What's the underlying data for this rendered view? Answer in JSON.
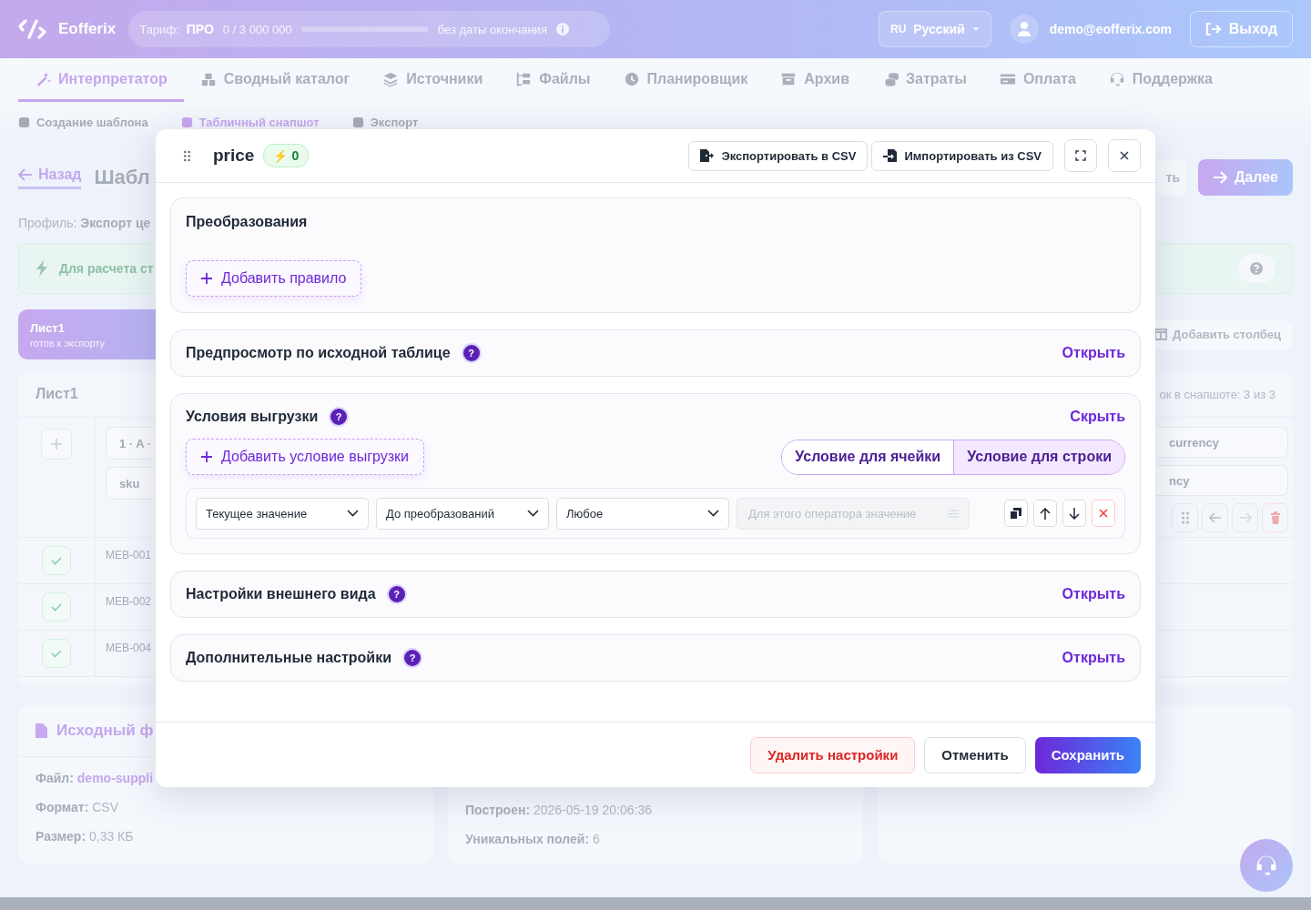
{
  "header": {
    "logo": "Eofferix",
    "plan": {
      "label": "Тариф:",
      "name": "ПРО",
      "usage": "0 / 3 000 000",
      "level": 0,
      "expiry": "без даты окончания"
    },
    "language": {
      "code": "RU",
      "name": "Русский"
    },
    "user_email": "demo@eofferix.com",
    "logout": "Выход"
  },
  "nav": [
    {
      "label": "Интерпретатор",
      "selected": true
    },
    {
      "label": "Сводный каталог",
      "selected": false
    },
    {
      "label": "Источники",
      "selected": false
    },
    {
      "label": "Файлы",
      "selected": false
    },
    {
      "label": "Планировщик",
      "selected": false
    },
    {
      "label": "Архив",
      "selected": false
    },
    {
      "label": "Затраты",
      "selected": false
    },
    {
      "label": "Оплата",
      "selected": false
    },
    {
      "label": "Поддержка",
      "selected": false
    }
  ],
  "subtabs": [
    {
      "label": "Создание шаблона",
      "selected": false
    },
    {
      "label": "Табличный снапшот",
      "selected": true
    },
    {
      "label": "Экспорт",
      "selected": false
    }
  ],
  "page": {
    "back": "Назад",
    "title": "Шабл",
    "cut_button": "ть",
    "next": "Далее",
    "profile_label": "Профиль:",
    "profile_value": "Экспорт це",
    "banner": "Для расчета ст",
    "sheet_card": {
      "name": "Лист1",
      "status": "готов к экспорту"
    },
    "add_column": "Добавить столбец",
    "panel": {
      "title": "Лист1",
      "info": "ок в снапшоте: 3 из 3",
      "left_headers": [
        "1 · A ·",
        "sku"
      ],
      "right_headers": [
        "currency",
        "ncy"
      ],
      "rows": [
        {
          "sku": "MEB-001",
          "checked": true
        },
        {
          "sku": "MEB-002",
          "checked": true
        },
        {
          "sku": "MEB-004",
          "checked": true
        }
      ]
    }
  },
  "info_cards": [
    {
      "title": "Исходный ф",
      "fields": [
        {
          "label": "Файл:",
          "value": "demo-suppli",
          "kind": "link"
        },
        {
          "label": "Формат:",
          "value": "CSV",
          "kind": "text"
        },
        {
          "label": "Размер:",
          "value": "0,33 КБ",
          "kind": "text"
        }
      ]
    },
    {
      "fields": [
        {
          "label": "Построен:",
          "value": "2026-05-19 20:06:36",
          "kind": "text"
        },
        {
          "label": "Уникальных полей:",
          "value": "6",
          "kind": "text"
        }
      ]
    }
  ],
  "modal": {
    "title": "price",
    "badge": {
      "icon": "⚡",
      "count": "0"
    },
    "export": "Экспортировать в CSV",
    "import": "Импортировать из CSV",
    "sections": [
      {
        "kind": "rules",
        "title": "Преобразования",
        "add": "Добавить правило"
      },
      {
        "kind": "group",
        "title": "Предпросмотр по исходной таблице",
        "help": "?",
        "action": "Открыть",
        "expanded": false
      },
      {
        "kind": "group",
        "title": "Условия выгрузки",
        "help": "?",
        "action": "Скрыть",
        "expanded": true,
        "add": "Добавить условие выгрузки",
        "modes": [
          {
            "label": "Условие для ячейки",
            "selected": false
          },
          {
            "label": "Условие для строки",
            "selected": true
          }
        ],
        "row": {
          "selects": [
            "Текущее значение",
            "До преобразований",
            "Любое"
          ],
          "value_placeholder": "Для этого оператора значение",
          "value_disabled": true
        }
      },
      {
        "kind": "group",
        "title": "Настройки внешнего вида",
        "help": "?",
        "action": "Открыть",
        "expanded": false
      },
      {
        "kind": "group",
        "title": "Дополнительные настройки",
        "help": "?",
        "action": "Открыть",
        "expanded": false
      }
    ],
    "footer": {
      "delete": "Удалить настройки",
      "cancel": "Отменить",
      "save": "Сохранить"
    }
  }
}
